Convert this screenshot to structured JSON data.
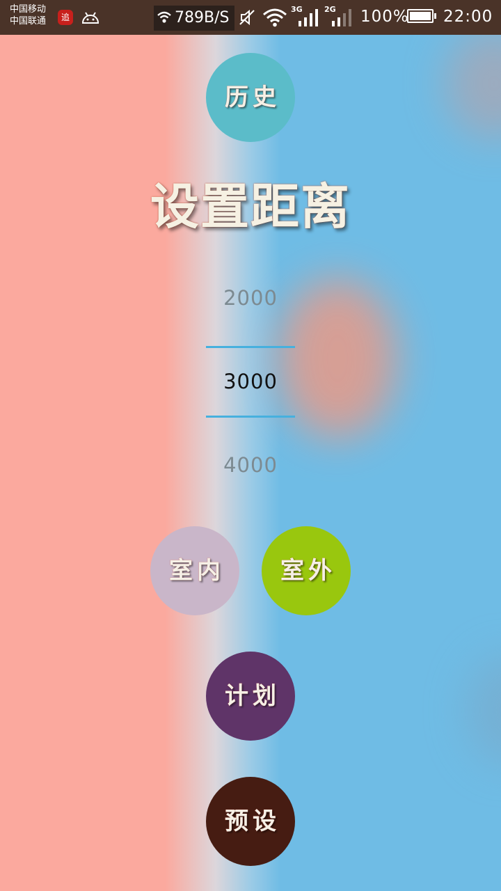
{
  "status_bar": {
    "carrier_1": "中国移动",
    "carrier_2": "中国联通",
    "notif_badge": "追",
    "net_speed": "789B/S",
    "signal_1_label": "3G",
    "signal_2_label": "2G",
    "battery_percent": "100%",
    "battery_level": 1.0,
    "time": "22:00",
    "icons": [
      "app-notification-icon",
      "android-icon",
      "wifi-icon",
      "mute-icon",
      "wifi-signal-icon",
      "cellular-signal-icon",
      "battery-icon"
    ]
  },
  "main": {
    "history_button": "历史",
    "title": "设置距离",
    "picker": {
      "above": "2000",
      "selected": "3000",
      "below": "4000"
    },
    "indoor_button": "室内",
    "outdoor_button": "室外",
    "plan_button": "计划",
    "preset_button": "预设"
  },
  "colors": {
    "background_left": "#fba99e",
    "background_right": "#6fbce5",
    "status_bar": "#4a3328",
    "history": "#5bbcc9",
    "indoor": "#c9b6c9",
    "outdoor": "#99c70e",
    "plan": "#5f3468",
    "preset": "#461c12",
    "picker_line": "#46b0de"
  }
}
